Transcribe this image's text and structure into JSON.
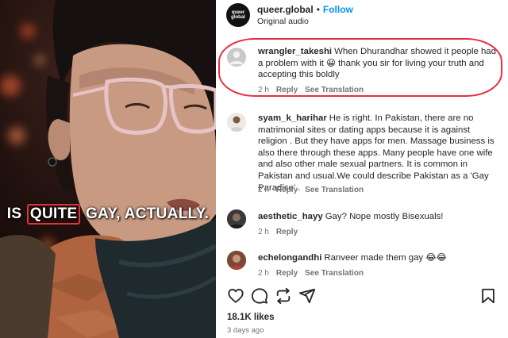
{
  "video": {
    "caption_before": "IS ",
    "caption_highlight": "QUITE",
    "caption_after": " GAY, ACTUALLY."
  },
  "post": {
    "avatar_text": "queer global",
    "username": "queer.global",
    "separator": "•",
    "follow_label": "Follow",
    "audio_label": "Original audio",
    "likes": "18.1K likes",
    "time": "3 days ago"
  },
  "comments": [
    {
      "username": "wrangler_takeshi",
      "text": "When Dhurandhar showed it people had a problem with it 😀 thank you sir for living your truth and accepting this boldly",
      "age": "2 h",
      "reply_label": "Reply",
      "translate_label": "See Translation"
    },
    {
      "username": "syam_k_harihar",
      "text": "He is right. In Pakistan, there are no matrimonial sites or dating apps because it is against religion . But they have apps for men. Massage business is also there through these apps. Many people have one wife and also other male sexual partners. It is common in Pakistan and usual.We could describe Pakistan as a 'Gay Paradise'..",
      "age": "2 h",
      "reply_label": "Reply",
      "translate_label": "See Translation"
    },
    {
      "username": "aesthetic_hayy",
      "text": "Gay? Nope mostly Bisexuals!",
      "age": "2 h",
      "reply_label": "Reply"
    },
    {
      "username": "echelongandhi",
      "text": "Ranveer made them gay 😂😂",
      "age": "2 h",
      "reply_label": "Reply",
      "translate_label": "See Translation"
    }
  ],
  "colors": {
    "follow_blue": "#0095f6",
    "highlight_red": "#e4313f",
    "meta_gray": "#737373"
  },
  "icons": [
    "heart-icon",
    "comment-icon",
    "repost-icon",
    "share-icon",
    "bookmark-icon"
  ]
}
